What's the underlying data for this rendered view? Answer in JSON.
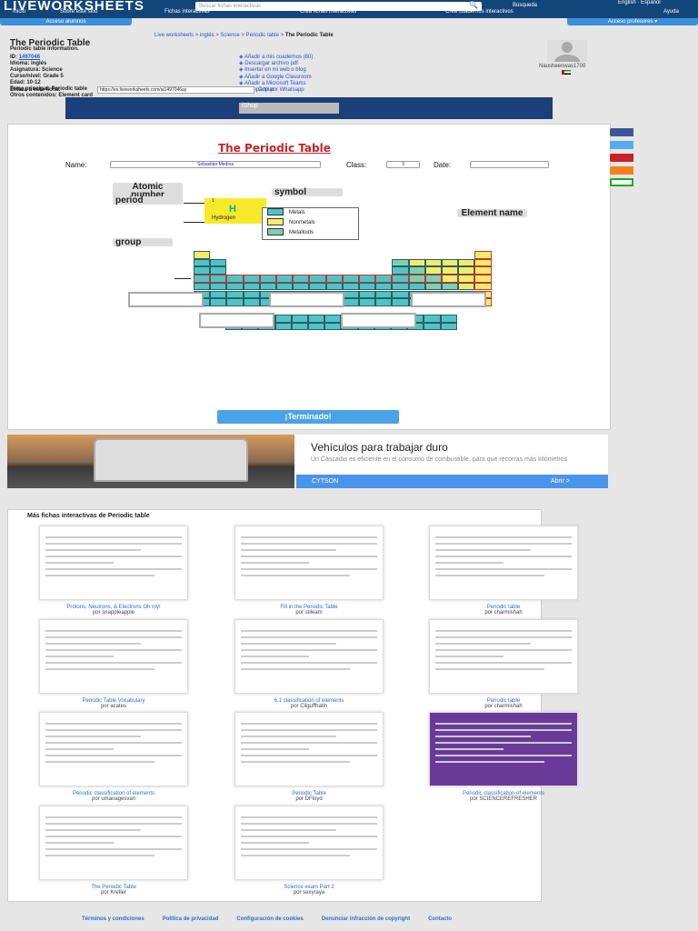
{
  "header": {
    "logo": "LIVEWORKSHEETS",
    "search_placeholder": "Buscar fichas interactivas",
    "search_button": "Búsqueda",
    "languages": "English · Español",
    "nav": [
      "Inicio",
      "Sobre este sitio",
      "Fichas interactivas",
      "Crea fichas interactivas",
      "Crea cuadernos interactivos",
      "Ayuda"
    ],
    "student_access": "Acceso alumnos",
    "teacher_access": "Acceso profesores ▾"
  },
  "breadcrumb": {
    "items": [
      "Live worksheets",
      "inglés",
      "Science",
      "Periodic table"
    ],
    "current": "The Periodic Table",
    "sep": " > "
  },
  "sheet": {
    "title": "The Periodic Table",
    "subtitle": "Periodic table information.",
    "meta": [
      {
        "k": "ID: ",
        "v": "1497046"
      },
      {
        "k": "Idioma: ",
        "v": "inglés"
      },
      {
        "k": "Asignatura: ",
        "v": "Science"
      },
      {
        "k": "Curso/nivel: ",
        "v": "Grade 5"
      },
      {
        "k": "Edad: ",
        "v": "10-12"
      },
      {
        "k": "Tema principal: ",
        "v": "Periodic table"
      },
      {
        "k": "Otros contenidos: ",
        "v": "Element card"
      }
    ],
    "actions": [
      "Añadir a mis cuadernos (80)",
      "Descargar archivo pdf",
      "Insertar en mi web o blog",
      "Añadir a Google Classroom",
      "Añadir a Microsoft Teams",
      "Compartir por Whatsapp"
    ],
    "author": "Nausheenwas1700",
    "link_label": "Enlaza a esta ficha:",
    "link_value": "https://es.liveworksheets.com/ai1497046ay",
    "copy": "Copiar"
  },
  "ad_top": {
    "label": "iShop"
  },
  "worksheet": {
    "title": "The Periodic Table",
    "name_label": "Name:",
    "name_value": "Sebastián Medina",
    "class_label": "Class:",
    "class_value": "3",
    "date_label": "Date:",
    "date_value": "",
    "tags": {
      "atomic": "Atomic number",
      "period": "period",
      "symbol": "symbol",
      "group": "group",
      "element": "Element name"
    },
    "h_number": "1",
    "h_symbol": "H",
    "h_name": "Hydrogen",
    "legend": [
      {
        "label": "Metals",
        "color": "#4fc4c8"
      },
      {
        "label": "Nonmetals",
        "color": "#f6ec6c"
      },
      {
        "label": "Metalloids",
        "color": "#7fcfb0"
      }
    ],
    "done": "¡Terminado!"
  },
  "ad_bottom": {
    "title": "Vehículos para trabajar duro",
    "text": "Un Cascadia es eficiente en el consumo de combustible, para que recorras más kilómetros",
    "brand": "CYTSON",
    "cta": "Abrir >"
  },
  "more": {
    "title": "Más fichas interactivas de Periodic table",
    "cards": [
      {
        "title": "Protons, Neutrons, & Electrons Oh my!",
        "author": "por snappleapple"
      },
      {
        "title": "Fill in the Periodic Table",
        "author": "por stileam"
      },
      {
        "title": "Periodic table",
        "author": "por charmishah"
      },
      {
        "title": "Periodic Table Vocabulary",
        "author": "por acates"
      },
      {
        "title": "6.1 classification of elements",
        "author": "por Cilguffhatin"
      },
      {
        "title": "Periodic table",
        "author": "por charmishah"
      },
      {
        "title": "Periodic classification of elements",
        "author": "por umanagesvari"
      },
      {
        "title": "Periodic Table",
        "author": "por DFloyd"
      },
      {
        "title": "Periodic classification of elements",
        "author": "por SCIENCEREFRESHER"
      },
      {
        "title": "The Periodic Table",
        "author": "por Kretler"
      },
      {
        "title": "Science exam Part 2",
        "author": "por sexyraya"
      }
    ]
  },
  "footer": [
    "Términos y condiciones",
    "Política de privacidad",
    "Configuración de cookies",
    "Denunciar infracción de copyright",
    "Contacto"
  ]
}
